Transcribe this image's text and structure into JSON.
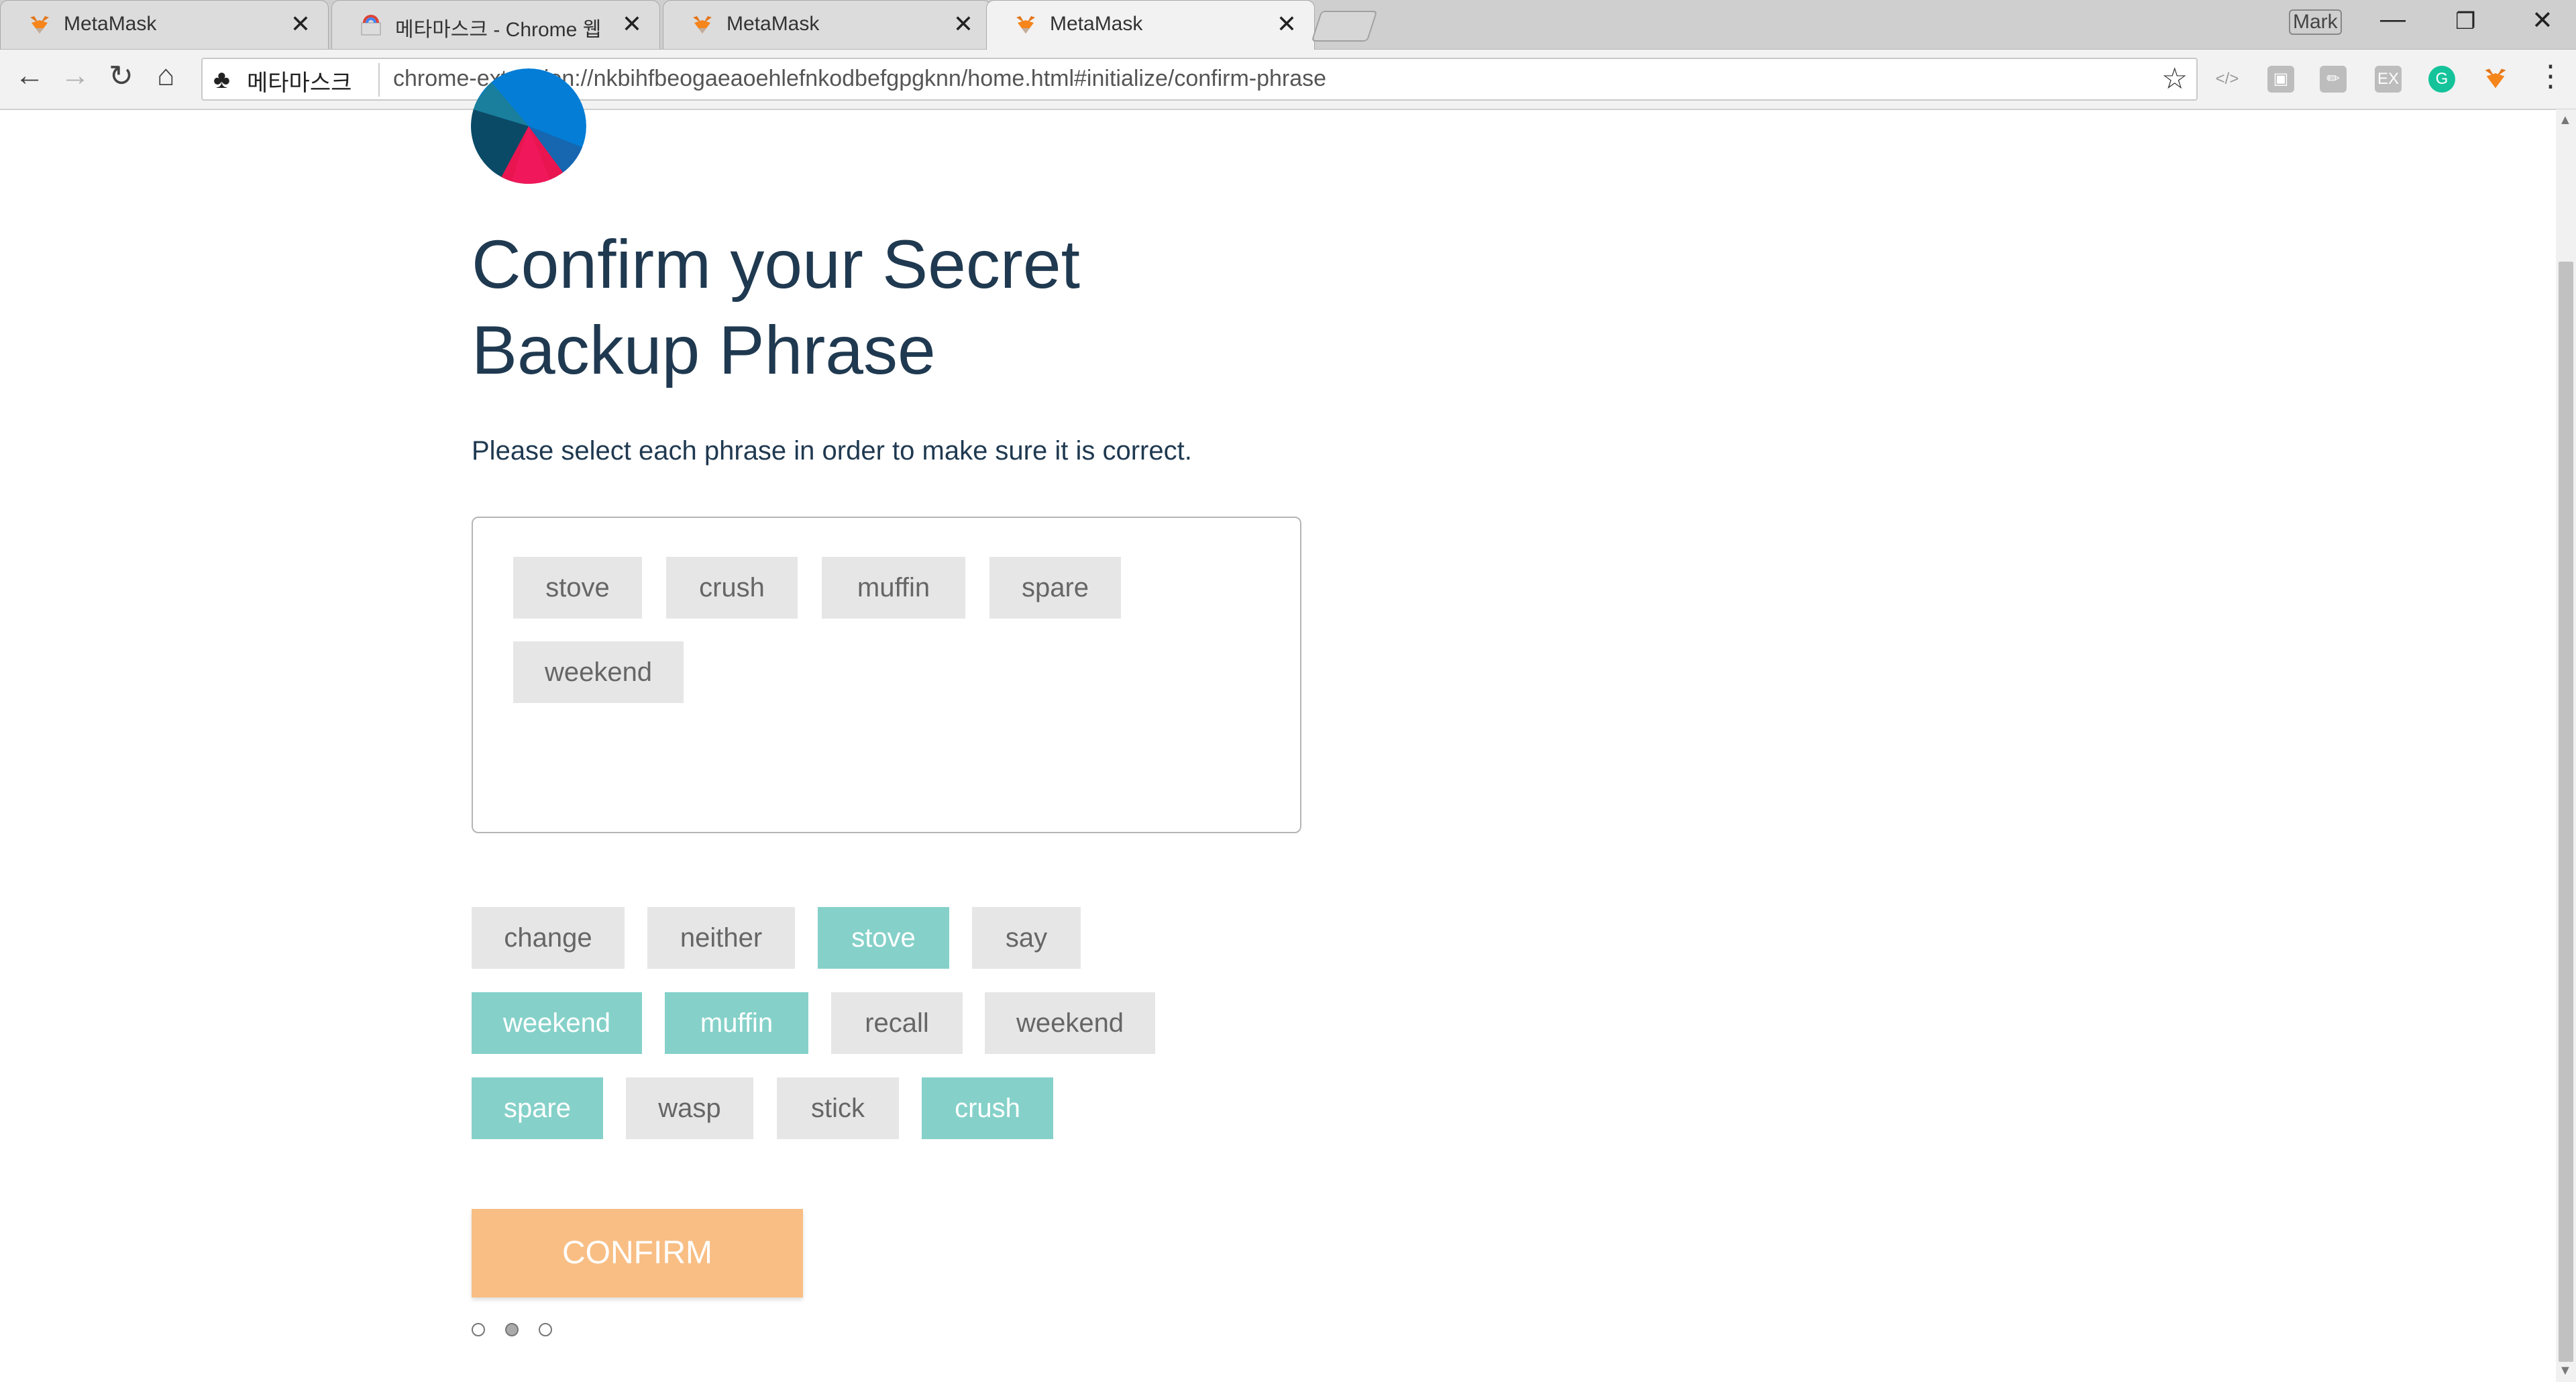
{
  "browser": {
    "tabs": [
      {
        "title": "MetaMask",
        "icon": "metamask-fox-icon",
        "active": false
      },
      {
        "title": "메타마스크 - Chrome 웹",
        "icon": "chrome-webstore-icon",
        "active": false
      },
      {
        "title": "MetaMask",
        "icon": "metamask-fox-icon",
        "active": false
      },
      {
        "title": "MetaMask",
        "icon": "metamask-fox-icon",
        "active": true
      }
    ],
    "close_glyph": "✕",
    "user_name": "Mark",
    "site_name": "메타마스크",
    "url": "chrome-extension://nkbihfbeogaeaoehlefnkodbefgpgknn/home.html#initialize/confirm-phrase",
    "ext_labels": [
      "EX"
    ]
  },
  "page": {
    "heading": "Confirm your Secret Backup Phrase",
    "subtitle": "Please select each phrase in order to make sure it is correct.",
    "selected_words": [
      "stove",
      "crush",
      "muffin",
      "spare",
      "weekend"
    ],
    "word_bank": [
      {
        "word": "change",
        "selected": false
      },
      {
        "word": "neither",
        "selected": false
      },
      {
        "word": "stove",
        "selected": true
      },
      {
        "word": "say",
        "selected": false
      },
      {
        "word": "weekend",
        "selected": true
      },
      {
        "word": "muffin",
        "selected": true
      },
      {
        "word": "recall",
        "selected": false
      },
      {
        "word": "weekend",
        "selected": false
      },
      {
        "word": "spare",
        "selected": true
      },
      {
        "word": "wasp",
        "selected": false
      },
      {
        "word": "stick",
        "selected": false
      },
      {
        "word": "crush",
        "selected": true
      }
    ],
    "confirm_label": "CONFIRM",
    "steps": {
      "total": 3,
      "current": 2
    }
  },
  "colors": {
    "heading": "#1f3950",
    "chip_default": "#e6e6e6",
    "chip_selected": "#85d1c9",
    "confirm_button": "#f8be84"
  }
}
